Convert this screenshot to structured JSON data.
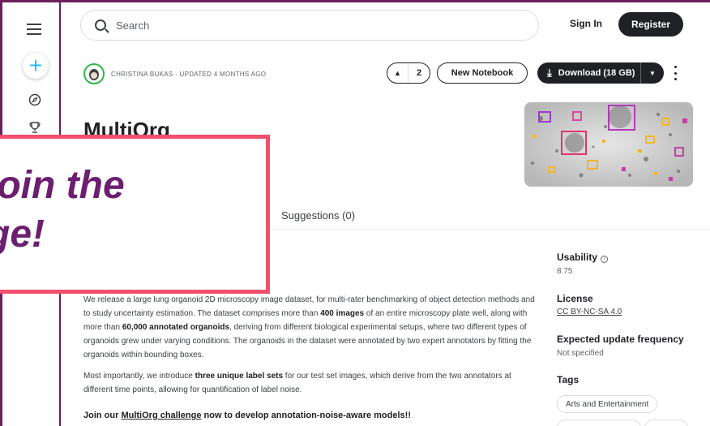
{
  "search": {
    "placeholder": "Search"
  },
  "header": {
    "signin_label": "Sign In",
    "register_label": "Register"
  },
  "sidebar": {
    "items": [
      {
        "name": "menu",
        "icon": "hamburger-icon"
      },
      {
        "name": "create",
        "icon": "plus-icon"
      },
      {
        "name": "explore",
        "icon": "compass-icon"
      },
      {
        "name": "competitions",
        "icon": "trophy-icon"
      }
    ]
  },
  "dataset": {
    "byline": "CHRISTINA BUKAS · UPDATED 4 MONTHS AGO",
    "upvotes": "2",
    "new_notebook_label": "New Notebook",
    "download_label": "Download (18 GB)",
    "title": "MultiOrg",
    "tab_suggestions": "Suggestions (0)"
  },
  "banner": {
    "line1": "join the",
    "line2": "ge!"
  },
  "description": {
    "p1_a": "We release a large lung organoid 2D microscopy image dataset, for multi-rater benchmarking of object detection methods and to study uncertainty estimation. The dataset comprises more than ",
    "p1_b1": "400 images",
    "p1_c": " of an entire microscopy plate well, along with more than ",
    "p1_b2": "60,000 annotated organoids",
    "p1_d": ", deriving from different biological experimental setups, where two different types of organoids grew under varying conditions. The organoids in the dataset were annotated by two expert annotators by fitting the organoids within bounding boxes.",
    "p2_a": "Most importantly, we introduce ",
    "p2_b": "three unique label sets",
    "p2_c": " for our test set images, which derive from the two annotators at different time points, allowing for quantification of label noise.",
    "p3_a": "Join our ",
    "p3_link": "MultiOrg challenge",
    "p3_b": " now to develop annotation-noise-aware models!!"
  },
  "meta": {
    "usability_label": "Usability",
    "usability_value": "8.75",
    "license_label": "License",
    "license_value": "CC BY-NC-SA 4.0",
    "update_label": "Expected update frequency",
    "update_value": "Not specified",
    "tags_label": "Tags",
    "tags": [
      "Arts and Entertainment"
    ]
  },
  "colors": {
    "accent": "#20beff",
    "banner_border": "#f0506e",
    "banner_text": "#6b1f6e",
    "frame": "#6b1f5c"
  }
}
